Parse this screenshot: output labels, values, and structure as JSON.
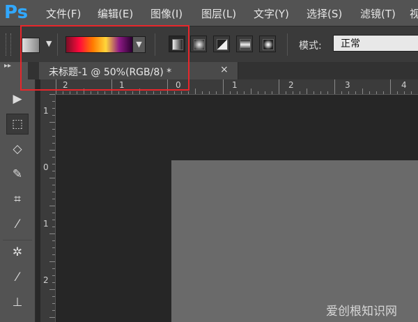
{
  "app": {
    "logo": "Ps"
  },
  "menu": [
    "文件(F)",
    "编辑(E)",
    "图像(I)",
    "图层(L)",
    "文字(Y)",
    "选择(S)",
    "滤镜(T)",
    "视"
  ],
  "options": {
    "gradient_colors": [
      "#7a0e25",
      "#ff0a3c",
      "#ff7a00",
      "#ffd63a",
      "#8e1a85",
      "#2a0030"
    ],
    "gradient_types": [
      "linear-gradient-icon",
      "radial-gradient-icon",
      "angle-gradient-icon",
      "reflected-gradient-icon",
      "diamond-gradient-icon"
    ],
    "mode_label": "模式:",
    "mode_value": "正常"
  },
  "document": {
    "tab_title": "未标题-1 @ 50%(RGB/8) *",
    "close": "×"
  },
  "ruler_h_labels": [
    "2",
    "1",
    "0",
    "1",
    "2",
    "3",
    "4"
  ],
  "ruler_v_labels": [
    "1",
    "0",
    "1",
    "2"
  ],
  "watermark": "爱创根知识网"
}
